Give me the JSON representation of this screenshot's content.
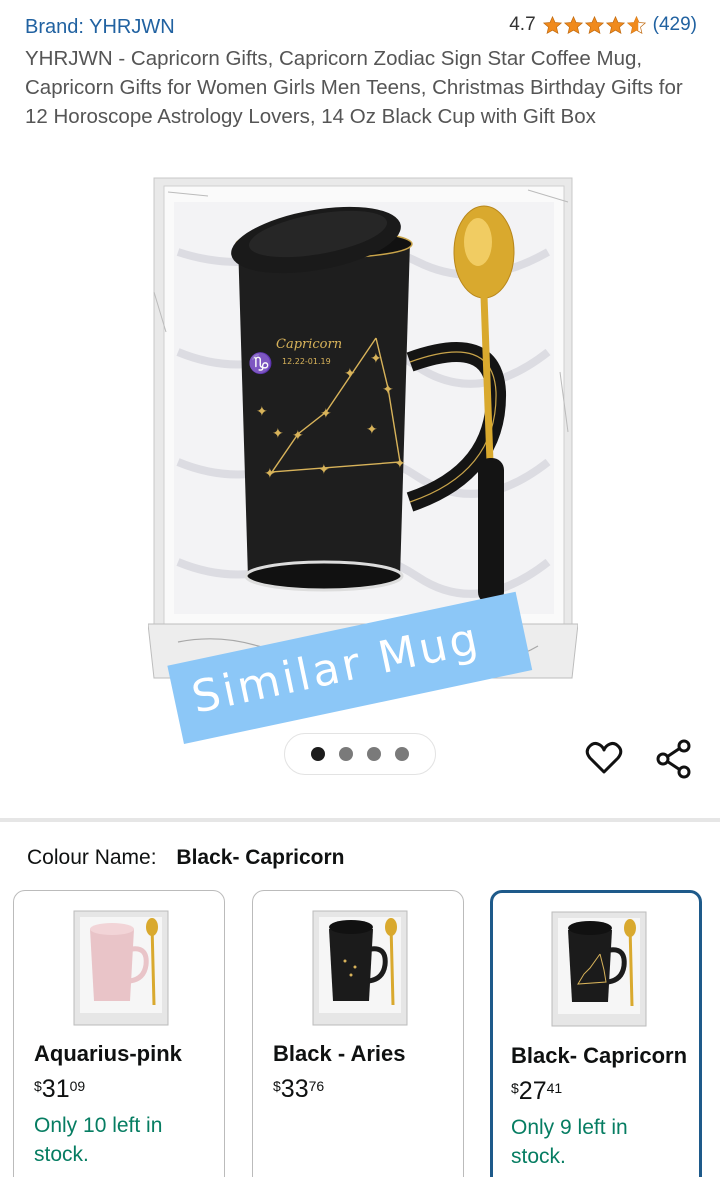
{
  "product": {
    "brand": "Brand: YHRJWN",
    "rating": "4.7",
    "rating_value": 4.7,
    "review_count": "(429)",
    "title": "YHRJWN - Capricorn Gifts, Capricorn Zodiac Sign Star Coffee Mug, Capricorn Gifts for Women Girls Men Teens, Christmas Birthday Gifts for 12 Horoscope Astrology Lovers, 14 Oz Black Cup with Gift Box"
  },
  "image": {
    "mug_text": "Capricorn",
    "mug_dates": "12.22-01.19",
    "overlay_text": "Similar Mug",
    "dot_count": 4,
    "active_dot": 0
  },
  "actions": {
    "heart_icon": "heart-icon",
    "share_icon": "share-icon"
  },
  "variants": {
    "label": "Colour Name:",
    "selected": "Black- Capricorn",
    "items": [
      {
        "name": "Aquarius-pink",
        "currency": "$",
        "whole": "31",
        "fraction": "09",
        "stock": "Only 10 left in stock.",
        "mug_color": "#e9c4c8"
      },
      {
        "name": "Black - Aries",
        "currency": "$",
        "whole": "33",
        "fraction": "76",
        "stock": "",
        "mug_color": "#1b1b1b"
      },
      {
        "name": "Black- Capricorn",
        "currency": "$",
        "whole": "27",
        "fraction": "41",
        "stock": "Only 9 left in stock.",
        "mug_color": "#1b1b1b"
      }
    ]
  },
  "colors": {
    "link": "#2162a1",
    "star": "#f08a1c",
    "stock": "#067d62",
    "selected_border": "#1e5a8a",
    "overlay": "#8cc7f7"
  }
}
